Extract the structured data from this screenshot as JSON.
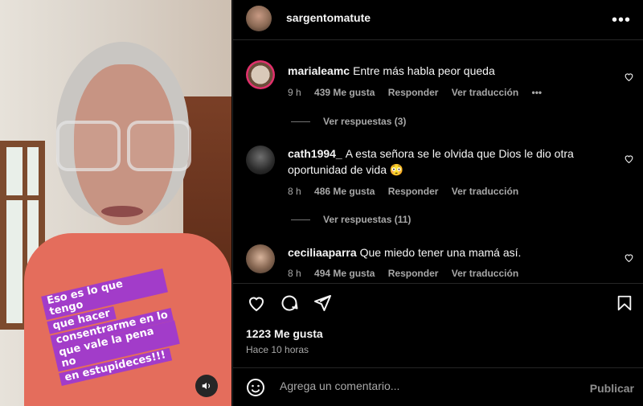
{
  "post": {
    "username": "sargentomatute",
    "more_label": "•••",
    "sticker_lines": [
      "Eso es lo que tengo",
      "que hacer",
      "consentrarme en lo",
      "que vale la pena no",
      "en estupideces!!!"
    ]
  },
  "comments": [
    {
      "user": "marialeamc",
      "text": "Entre más habla peor queda",
      "time": "9 h",
      "likes": "439 Me gusta",
      "reply": "Responder",
      "translate": "Ver traducción",
      "options": "•••",
      "replies": "Ver respuestas (3)"
    },
    {
      "user": "cath1994_",
      "text": "A esta señora se le olvida que Dios le dio otra oportunidad de vida 😳",
      "time": "8 h",
      "likes": "486 Me gusta",
      "reply": "Responder",
      "translate": "Ver traducción",
      "replies": "Ver respuestas (11)"
    },
    {
      "user": "ceciliaaparra",
      "text": "Que miedo tener una mamá así.",
      "time": "8 h",
      "likes": "494 Me gusta",
      "reply": "Responder",
      "translate": "Ver traducción"
    }
  ],
  "stats": {
    "likes": "1223 Me gusta",
    "posted": "Hace 10 horas"
  },
  "composer": {
    "placeholder": "Agrega un comentario...",
    "publish": "Publicar"
  },
  "icons": [
    "more-icon",
    "heart-icon",
    "comment-icon",
    "share-icon",
    "bookmark-icon",
    "emoji-icon",
    "volume-icon"
  ]
}
